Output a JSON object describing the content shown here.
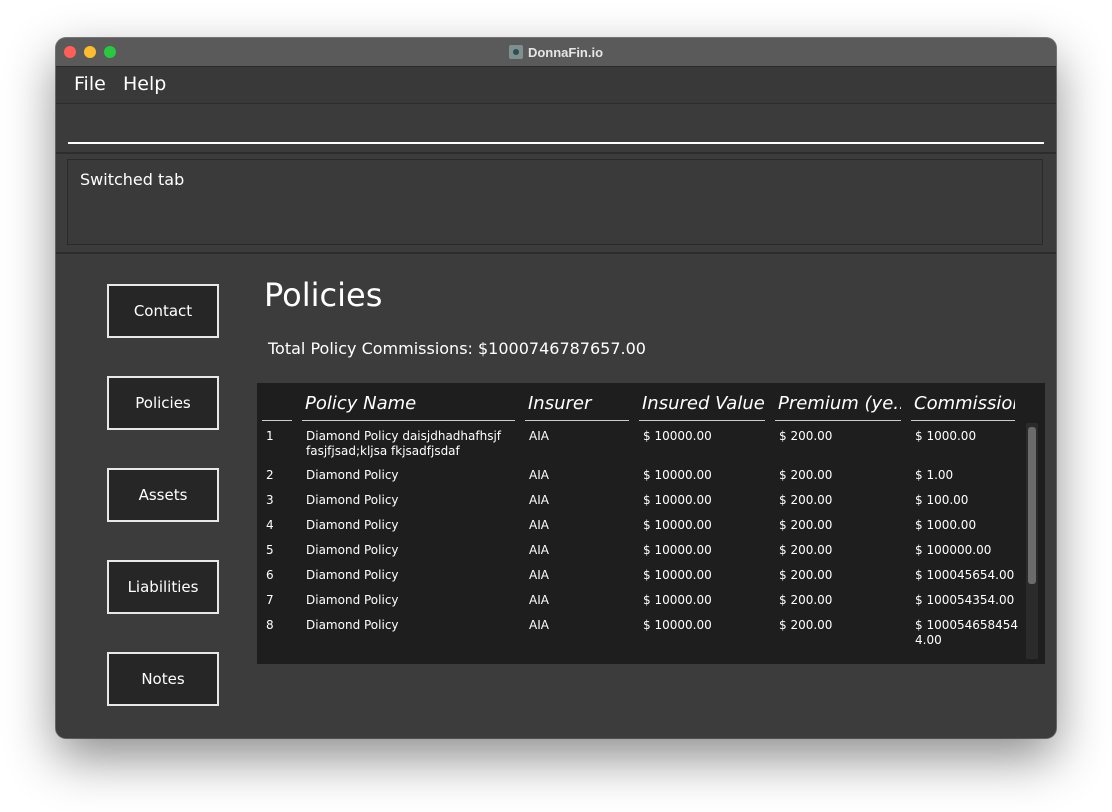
{
  "window": {
    "title": "DonnaFin.io"
  },
  "menubar": {
    "file": "File",
    "help": "Help"
  },
  "command": {
    "value": ""
  },
  "result": {
    "text": "Switched tab"
  },
  "nav": {
    "contact": "Contact",
    "policies": "Policies",
    "assets": "Assets",
    "liabilities": "Liabilities",
    "notes": "Notes"
  },
  "main": {
    "title": "Policies",
    "commission_summary": "Total Policy Commissions: $1000746787657.00"
  },
  "table": {
    "headers": [
      "Policy Name",
      "Insurer",
      "Insured Value",
      "Premium (ye...",
      "Commission"
    ],
    "rows": [
      {
        "index": "1",
        "name": "Diamond Policy daisjdhadhafhsjf fasjfjsad;kljsa fkjsadfjsdaf",
        "insurer": "AIA",
        "insured": "$ 10000.00",
        "premium": "$ 200.00",
        "commission": "$ 1000.00"
      },
      {
        "index": "2",
        "name": "Diamond Policy",
        "insurer": "AIA",
        "insured": "$ 10000.00",
        "premium": "$ 200.00",
        "commission": "$ 1.00"
      },
      {
        "index": "3",
        "name": "Diamond Policy",
        "insurer": "AIA",
        "insured": "$ 10000.00",
        "premium": "$ 200.00",
        "commission": "$ 100.00"
      },
      {
        "index": "4",
        "name": "Diamond Policy",
        "insurer": "AIA",
        "insured": "$ 10000.00",
        "premium": "$ 200.00",
        "commission": "$ 1000.00"
      },
      {
        "index": "5",
        "name": "Diamond Policy",
        "insurer": "AIA",
        "insured": "$ 10000.00",
        "premium": "$ 200.00",
        "commission": "$ 100000.00"
      },
      {
        "index": "6",
        "name": "Diamond Policy",
        "insurer": "AIA",
        "insured": "$ 10000.00",
        "premium": "$ 200.00",
        "commission": "$ 100045654.00"
      },
      {
        "index": "7",
        "name": "Diamond Policy",
        "insurer": "AIA",
        "insured": "$ 10000.00",
        "premium": "$ 200.00",
        "commission": "$ 100054354.00"
      },
      {
        "index": "8",
        "name": "Diamond Policy",
        "insurer": "AIA",
        "insured": "$ 10000.00",
        "premium": "$ 200.00",
        "commission": "$ 1000546584544.00"
      }
    ]
  }
}
